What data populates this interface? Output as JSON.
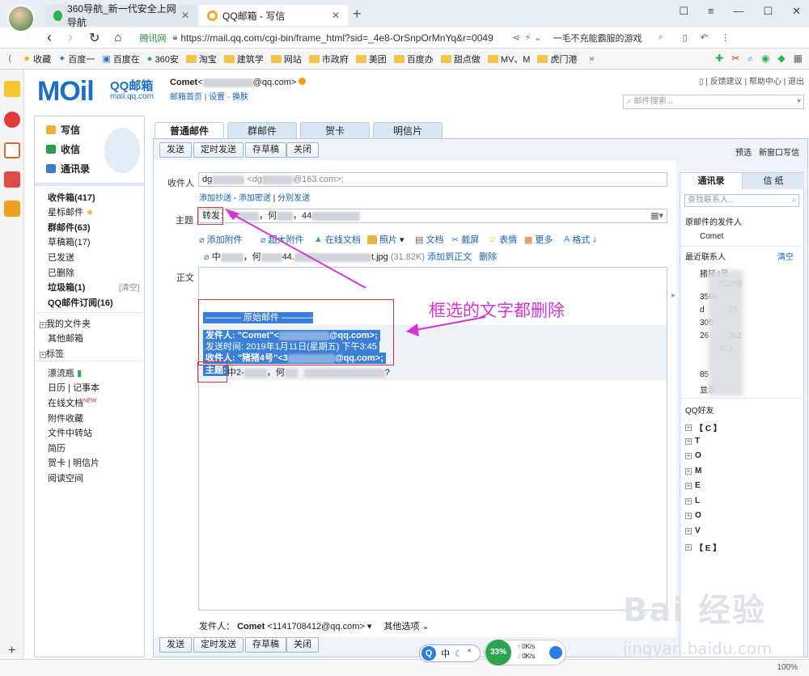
{
  "browser": {
    "tabs": [
      {
        "label": "360导航_新一代安全上网导航"
      },
      {
        "label": "QQ邮箱 - 写信"
      }
    ],
    "new_tab": "+",
    "url": "https://mail.qq.com/cgi-bin/frame_html?sid=_4e8-OrSnpOrMnYq&r=0049",
    "site_badge": "腾讯网",
    "search_hint": "一毛不充能霸服的游戏",
    "bookmarks": [
      "收藏",
      "百度一",
      "百度在",
      "360安",
      "淘宝",
      "建筑学",
      "网站",
      "市政府",
      "美团",
      "百度办",
      "甜点做",
      "MV、M",
      "虎门港"
    ]
  },
  "header": {
    "logo": "MOil",
    "brand": "QQ邮箱",
    "brand_sub": "mail.qq.com",
    "user_name": "Comet",
    "user_email_suffix": "@qq.com>",
    "user_links": [
      "邮箱首页",
      "设置",
      "换肤"
    ],
    "top_links": [
      "反馈建议",
      "帮助中心",
      "退出"
    ],
    "search_placeholder": "邮件搜索..."
  },
  "sidebar": {
    "main": [
      {
        "label": "写信"
      },
      {
        "label": "收信"
      },
      {
        "label": "通讯录"
      }
    ],
    "folders": [
      {
        "label": "收件箱(417)"
      },
      {
        "label": "星标邮件"
      },
      {
        "label": "群邮件(63)"
      },
      {
        "label": "草稿箱(17)"
      },
      {
        "label": "已发送"
      },
      {
        "label": "已删除"
      },
      {
        "label": "垃圾箱(1)",
        "action": "[清空]"
      },
      {
        "label": "QQ邮件订阅(16)"
      }
    ],
    "more": [
      {
        "label": "我的文件夹"
      },
      {
        "label": "其他邮箱"
      },
      {
        "label": "标签"
      }
    ],
    "apps": [
      {
        "label": "漂流瓶"
      },
      {
        "label": "日历",
        "extra": "记事本"
      },
      {
        "label": "在线文档",
        "badge": "NEW"
      },
      {
        "label": "附件收藏"
      },
      {
        "label": "文件中转站"
      },
      {
        "label": "简历"
      },
      {
        "label": "贺卡",
        "extra": "明信片"
      },
      {
        "label": "阅读空间"
      }
    ]
  },
  "compose": {
    "tabs": [
      "普通邮件",
      "群邮件",
      "贺卡",
      "明信片"
    ],
    "toolbar": [
      "发送",
      "定时发送",
      "存草稿",
      "关闭"
    ],
    "preview": "预选",
    "new_window": "新窗口写信",
    "to_label": "收件人",
    "to_value_prefix": "dg",
    "to_value_mid": "<dg",
    "to_value_suffix": "@163.com>;",
    "to_links": [
      "添加抄送",
      "添加密送",
      "分别发送"
    ],
    "subject_label": "主题",
    "subject_prefix": "转发：",
    "subject_rest": "中",
    "subject_more": "，何",
    "subject_num": "，44",
    "editor_tools": [
      "添加附件",
      "超大附件",
      "在线文档",
      "照片",
      "文档",
      "截屏",
      "表情",
      "更多",
      "格式"
    ],
    "attachment": {
      "name_prefix": "中",
      "name_mid": "，何",
      "name_num": "44.",
      "ext": "t.jpg",
      "size": "(31.82K)",
      "actions": [
        "添加到正文",
        "删除"
      ]
    },
    "body_label": "正文",
    "quote": {
      "header": "———— 原始邮件 ————",
      "from": "发件人: \"Comet\"<",
      "from_suffix": "@qq.com>;",
      "time": "发送时间: 2019年1月11日(星期五) 下午3:45",
      "to": "收件人: \"猪猪4号\"<3",
      "to_suffix": "@qq.com>;",
      "subject_key": "主题:",
      "subject_val": "中2-",
      "subject_val_mid": "，何",
      "subject_val_end": "?"
    },
    "sender_label": "发件人：",
    "sender_name": "Comet",
    "sender_email": "<1141708412@qq.com>",
    "other_options": "其他选项"
  },
  "right_panel": {
    "tabs": [
      "通讯录",
      "信 纸"
    ],
    "search_placeholder": "查找联系人...",
    "original_sender_title": "原邮件的发件人",
    "original_sender": "Comet",
    "recent_title": "最近联系人",
    "clear": "清空",
    "recent": [
      "猪猪4号",
      "71268",
      "3599",
      "d",
      "39",
      "305",
      "26",
      "362",
      "213",
      "85",
      "显示"
    ],
    "qq_friends_title": "QQ好友",
    "groups": [
      "【 C 】",
      "T",
      "O",
      "M",
      "E",
      "L",
      "O",
      "V",
      "【 E 】"
    ]
  },
  "annotation": {
    "text": "框选的文字都删除"
  },
  "status": {
    "ime": "中",
    "percent": "33%",
    "net_up": "0K/s",
    "net_down": "0K/s",
    "zoom": "100%"
  },
  "watermark": {
    "logo": "Bai 经验",
    "url": "jingyan.baidu.com"
  },
  "colors": {
    "accent": "#1c6fc6",
    "annotation": "#d535d5",
    "box": "#e0303a",
    "selection": "#3a7fd8"
  }
}
